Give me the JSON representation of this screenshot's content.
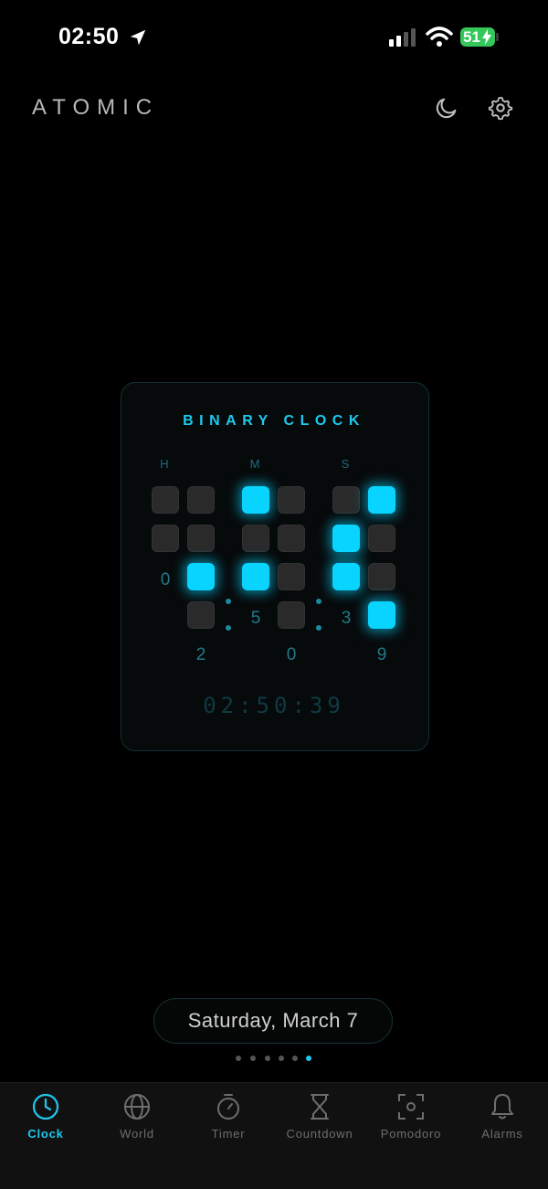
{
  "status": {
    "time": "02:50",
    "battery": "51"
  },
  "header": {
    "title": "ATOMIC",
    "icons": [
      "moon-icon",
      "gear-icon"
    ]
  },
  "clock_card": {
    "title": "BINARY CLOCK",
    "column_labels": {
      "hours": "H",
      "minutes": "M",
      "seconds": "S"
    },
    "digits": {
      "hours_tens": "0",
      "hours_ones": "2",
      "minutes_tens": "5",
      "minutes_ones": "0",
      "seconds_tens": "3",
      "seconds_ones": "9"
    },
    "digital_time": "02:50:39",
    "accent_color": "#08d4ff"
  },
  "date": "Saturday, March 7",
  "pager": {
    "count": 6,
    "active_index": 5
  },
  "tabs": [
    {
      "label": "Clock",
      "icon": "clock-icon",
      "active": true
    },
    {
      "label": "World",
      "icon": "globe-icon",
      "active": false
    },
    {
      "label": "Timer",
      "icon": "stopwatch-icon",
      "active": false
    },
    {
      "label": "Countdown",
      "icon": "hourglass-icon",
      "active": false
    },
    {
      "label": "Pomodoro",
      "icon": "focus-icon",
      "active": false
    },
    {
      "label": "Alarms",
      "icon": "bell-icon",
      "active": false
    }
  ]
}
